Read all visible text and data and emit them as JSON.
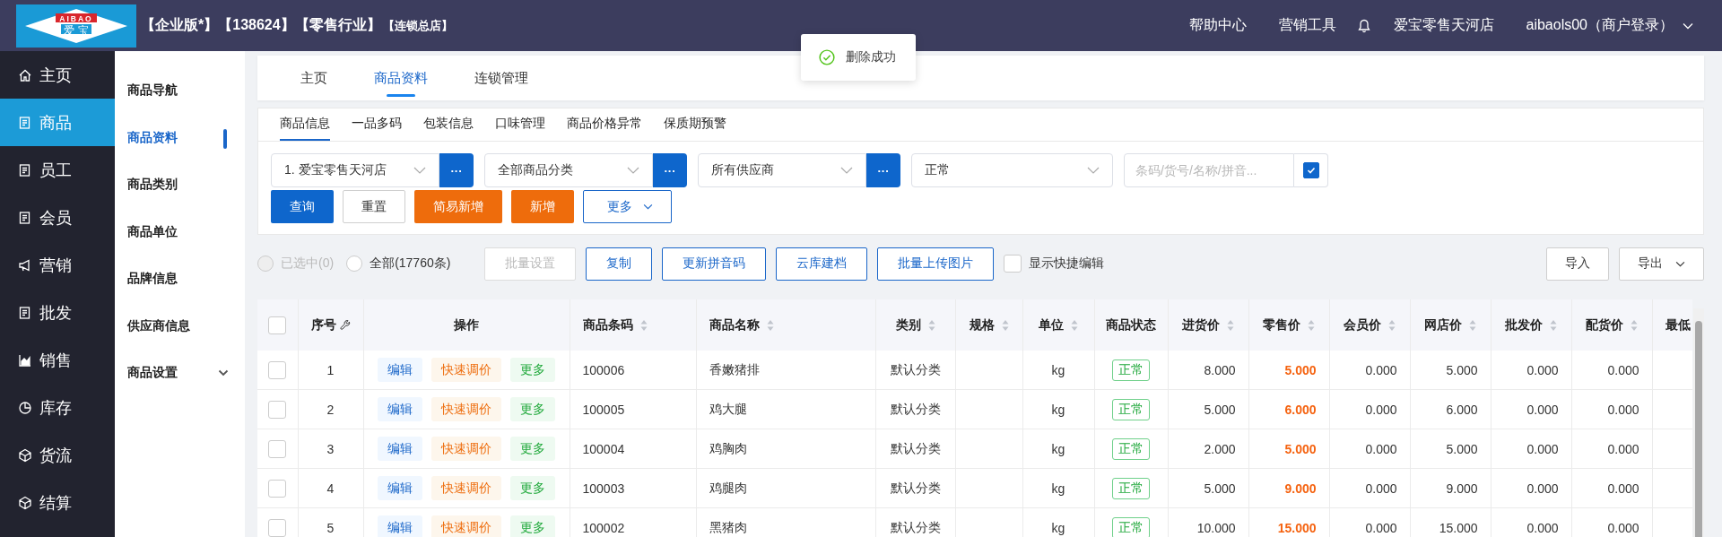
{
  "header": {
    "logo_text": "AIBAO",
    "logo_subtext": "爱 宝",
    "title": "【企业版*】【138624】【零售行业】",
    "subtitle": "【连锁总店】",
    "links": [
      "帮助中心",
      "营销工具"
    ],
    "store": "爱宝零售天河店",
    "user": "aibaols00（商户登录）"
  },
  "toast": {
    "message": "删除成功"
  },
  "sidebar": {
    "items": [
      {
        "label": "主页",
        "selected": false
      },
      {
        "label": "商品",
        "selected": true
      },
      {
        "label": "员工",
        "selected": false
      },
      {
        "label": "会员",
        "selected": false
      },
      {
        "label": "营销",
        "selected": false
      },
      {
        "label": "批发",
        "selected": false
      },
      {
        "label": "销售",
        "selected": false
      },
      {
        "label": "库存",
        "selected": false
      },
      {
        "label": "货流",
        "selected": false
      },
      {
        "label": "结算",
        "selected": false
      }
    ]
  },
  "subnav": {
    "items": [
      {
        "label": "商品导航",
        "selected": false,
        "kind": "link"
      },
      {
        "label": "商品资料",
        "selected": true,
        "kind": "link"
      },
      {
        "label": "商品类别",
        "selected": false,
        "kind": "link"
      },
      {
        "label": "商品单位",
        "selected": false,
        "kind": "link"
      },
      {
        "label": "品牌信息",
        "selected": false,
        "kind": "link"
      },
      {
        "label": "供应商信息",
        "selected": false,
        "kind": "link"
      },
      {
        "label": "商品设置",
        "selected": false,
        "kind": "group"
      }
    ]
  },
  "tabs": [
    {
      "label": "主页",
      "selected": false
    },
    {
      "label": "商品资料",
      "selected": true
    },
    {
      "label": "连锁管理",
      "selected": false
    }
  ],
  "subtabs": [
    {
      "label": "商品信息",
      "selected": true
    },
    {
      "label": "一品多码",
      "selected": false
    },
    {
      "label": "包装信息",
      "selected": false
    },
    {
      "label": "口味管理",
      "selected": false
    },
    {
      "label": "商品价格异常",
      "selected": false
    },
    {
      "label": "保质期预警",
      "selected": false
    }
  ],
  "filters": {
    "selects": [
      {
        "value": "1. 爱宝零售天河店",
        "has_picker": true,
        "picker_label": "···"
      },
      {
        "value": "全部商品分类",
        "has_picker": true,
        "picker_label": "···"
      },
      {
        "value": "所有供应商",
        "has_picker": true,
        "picker_label": "···"
      },
      {
        "value": "正常",
        "has_picker": false
      }
    ],
    "search": {
      "placeholder": "条码/货号/名称/拼音...",
      "checked": true
    }
  },
  "actions": [
    {
      "label": "查询",
      "kind": "primary"
    },
    {
      "label": "重置",
      "kind": "default"
    },
    {
      "label": "简易新增",
      "kind": "warning"
    },
    {
      "label": "新增",
      "kind": "warning"
    },
    {
      "label": "更多",
      "kind": "dropdown"
    }
  ],
  "toolbar": {
    "scope": [
      {
        "label": "已选中(0)",
        "selected": false,
        "disabled": true
      },
      {
        "label": "全部(17760条)",
        "selected": false,
        "disabled": false
      }
    ],
    "buttons": [
      {
        "label": "批量设置",
        "disabled": true
      },
      {
        "label": "复制",
        "disabled": false
      },
      {
        "label": "更新拼音码",
        "disabled": false
      },
      {
        "label": "云库建档",
        "disabled": false
      },
      {
        "label": "批量上传图片",
        "disabled": false
      }
    ],
    "quick_edit": {
      "label": "显示快捷编辑",
      "checked": false
    },
    "right_buttons": [
      {
        "label": "导入",
        "dropdown": false
      },
      {
        "label": "导出",
        "dropdown": true
      }
    ]
  },
  "table": {
    "select_all_checked": false,
    "columns": [
      {
        "label": "序号",
        "kind": "index"
      },
      {
        "label": "操作",
        "kind": "plain"
      },
      {
        "label": "商品条码",
        "kind": "sortable"
      },
      {
        "label": "商品名称",
        "kind": "sortable"
      },
      {
        "label": "类别",
        "kind": "sortable"
      },
      {
        "label": "规格",
        "kind": "sortable"
      },
      {
        "label": "单位",
        "kind": "sortable"
      },
      {
        "label": "商品状态",
        "kind": "plain"
      },
      {
        "label": "进货价",
        "kind": "sortable"
      },
      {
        "label": "零售价",
        "kind": "sortable"
      },
      {
        "label": "会员价",
        "kind": "sortable"
      },
      {
        "label": "网店价",
        "kind": "sortable"
      },
      {
        "label": "批发价",
        "kind": "sortable"
      },
      {
        "label": "配货价",
        "kind": "sortable"
      },
      {
        "label": "最低",
        "kind": "plain"
      }
    ],
    "rows": [
      {
        "checked": false,
        "index": "1",
        "actions": [
          "编辑",
          "快速调价",
          "更多"
        ],
        "barcode": "100006",
        "name": "香嫩猪排",
        "category": "默认分类",
        "unit": "kg",
        "status": "正常",
        "purchase_price": "8.000",
        "retail_price": "5.000",
        "member_price": "0.000",
        "online_price": "5.000",
        "wholesale_price": "0.000",
        "distribution_price": "0.000"
      },
      {
        "checked": false,
        "index": "2",
        "actions": [
          "编辑",
          "快速调价",
          "更多"
        ],
        "barcode": "100005",
        "name": "鸡大腿",
        "category": "默认分类",
        "unit": "kg",
        "status": "正常",
        "purchase_price": "5.000",
        "retail_price": "6.000",
        "member_price": "0.000",
        "online_price": "6.000",
        "wholesale_price": "0.000",
        "distribution_price": "0.000"
      },
      {
        "checked": false,
        "index": "3",
        "actions": [
          "编辑",
          "快速调价",
          "更多"
        ],
        "barcode": "100004",
        "name": "鸡胸肉",
        "category": "默认分类",
        "unit": "kg",
        "status": "正常",
        "purchase_price": "2.000",
        "retail_price": "5.000",
        "member_price": "0.000",
        "online_price": "5.000",
        "wholesale_price": "0.000",
        "distribution_price": "0.000"
      },
      {
        "checked": false,
        "index": "4",
        "actions": [
          "编辑",
          "快速调价",
          "更多"
        ],
        "barcode": "100003",
        "name": "鸡腿肉",
        "category": "默认分类",
        "unit": "kg",
        "status": "正常",
        "purchase_price": "5.000",
        "retail_price": "9.000",
        "member_price": "0.000",
        "online_price": "9.000",
        "wholesale_price": "0.000",
        "distribution_price": "0.000"
      },
      {
        "checked": false,
        "index": "5",
        "actions": [
          "编辑",
          "快速调价",
          "更多"
        ],
        "barcode": "100002",
        "name": "黑猪肉",
        "category": "默认分类",
        "unit": "kg",
        "status": "正常",
        "purchase_price": "10.000",
        "retail_price": "15.000",
        "member_price": "0.000",
        "online_price": "15.000",
        "wholesale_price": "0.000",
        "distribution_price": "0.000"
      }
    ]
  }
}
